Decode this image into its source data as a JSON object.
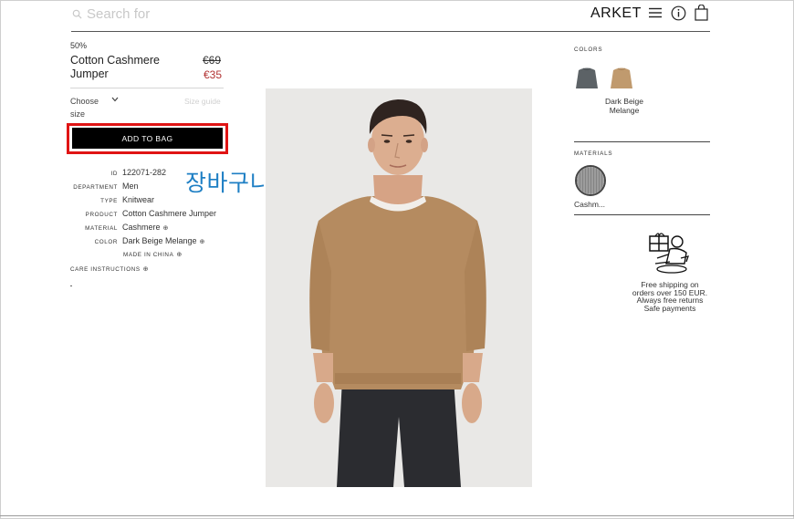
{
  "header": {
    "search_placeholder": "Search for",
    "brand": "ARKET",
    "icons": [
      "search-icon",
      "menu-icon",
      "info-icon",
      "bag-icon"
    ]
  },
  "product": {
    "discount": "50%",
    "name": "Cotton Cashmere Jumper",
    "old_price": "€69",
    "new_price": "€35",
    "size_label": "Choose size",
    "size_guide": "Size guide",
    "add_to_bag": "ADD TO BAG"
  },
  "annotation": {
    "text": "장바구니에 담기",
    "color": "#1e7fc4",
    "highlight_color": "#e01414"
  },
  "specs": [
    {
      "label": "ID",
      "value": "122071-282"
    },
    {
      "label": "DEPARTMENT",
      "value": "Men"
    },
    {
      "label": "TYPE",
      "value": "Knitwear"
    },
    {
      "label": "PRODUCT",
      "value": "Cotton Cashmere Jumper"
    },
    {
      "label": "MATERIAL",
      "value": "Cashmere"
    },
    {
      "label": "COLOR",
      "value": "Dark Beige Melange"
    }
  ],
  "made_in": "MADE IN CHINA",
  "care_instructions": "CARE INSTRUCTIONS",
  "colors": {
    "heading": "COLORS",
    "selected_name": "Dark Beige Melange",
    "swatches": [
      "#5c6266",
      "#c09a6e"
    ]
  },
  "materials": {
    "heading": "MATERIALS",
    "name": "Cashm..."
  },
  "promo": {
    "line1": "Free shipping on",
    "line2": "orders over 150 EUR.",
    "line3": "Always free returns",
    "line4": "Safe payments"
  },
  "colors_theme": {
    "sale_price": "#b23232",
    "button_bg": "#000000"
  }
}
